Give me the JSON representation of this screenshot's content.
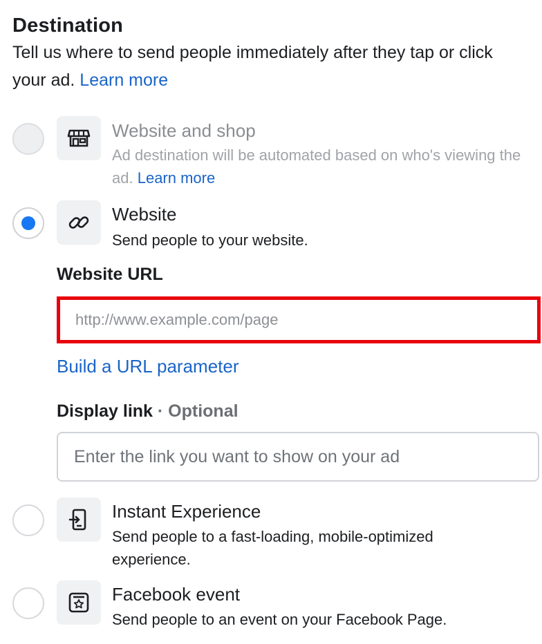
{
  "section": {
    "title": "Destination",
    "description": "Tell us where to send people immediately after they tap or click your ad.",
    "learn_more": "Learn more"
  },
  "options": [
    {
      "title": "Website and shop",
      "subtitle": "Ad destination will be automated based on who's viewing the ad.",
      "learn_more": "Learn more",
      "icon": "storefront-icon",
      "state": "disabled"
    },
    {
      "title": "Website",
      "subtitle": "Send people to your website.",
      "icon": "link-icon",
      "state": "selected"
    },
    {
      "title": "Instant Experience",
      "subtitle": "Send people to a fast-loading, mobile-optimized experience.",
      "icon": "mobile-enter-icon",
      "state": "unselected"
    },
    {
      "title": "Facebook event",
      "subtitle": "Send people to an event on your Facebook Page.",
      "icon": "event-star-icon",
      "state": "unselected"
    }
  ],
  "website_url": {
    "label": "Website URL",
    "placeholder": "http://www.example.com/page",
    "value": ""
  },
  "build_url_parameter": "Build a URL parameter",
  "display_link": {
    "label": "Display link",
    "optional": "· Optional",
    "placeholder": "Enter the link you want to show on your ad",
    "value": ""
  },
  "colors": {
    "link": "#1a64c8",
    "radio_selected": "#1877f2",
    "highlight_border": "#e8000b"
  }
}
